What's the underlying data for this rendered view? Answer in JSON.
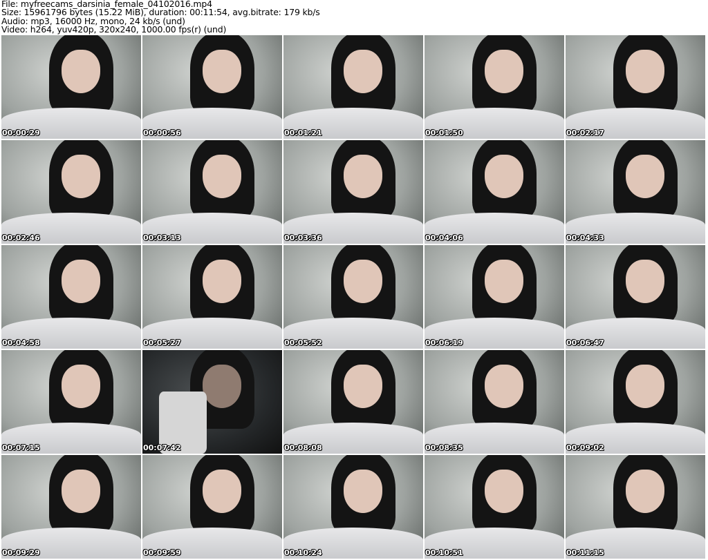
{
  "header": {
    "file": "File: myfreecams_darsinia_female_04102016.mp4",
    "size": "Size: 15961796 bytes (15.22 MiB), duration: 00:11:54, avg.bitrate: 179 kb/s",
    "audio": "Audio: mp3, 16000 Hz, mono, 24 kb/s (und)",
    "video": "Video: h264, yuv420p, 320x240, 1000.00 fps(r) (und)"
  },
  "thumbnails": [
    {
      "time": "00:00:29"
    },
    {
      "time": "00:00:56"
    },
    {
      "time": "00:01:21"
    },
    {
      "time": "00:01:50"
    },
    {
      "time": "00:02:17"
    },
    {
      "time": "00:02:46"
    },
    {
      "time": "00:03:13"
    },
    {
      "time": "00:03:36"
    },
    {
      "time": "00:04:06"
    },
    {
      "time": "00:04:33"
    },
    {
      "time": "00:04:58"
    },
    {
      "time": "00:05:27"
    },
    {
      "time": "00:05:52"
    },
    {
      "time": "00:06:19"
    },
    {
      "time": "00:06:47"
    },
    {
      "time": "00:07:15"
    },
    {
      "time": "00:07:42",
      "dark": true
    },
    {
      "time": "00:08:08"
    },
    {
      "time": "00:08:35"
    },
    {
      "time": "00:09:02"
    },
    {
      "time": "00:09:29"
    },
    {
      "time": "00:09:59"
    },
    {
      "time": "00:10:24"
    },
    {
      "time": "00:10:51"
    },
    {
      "time": "00:11:15"
    }
  ]
}
